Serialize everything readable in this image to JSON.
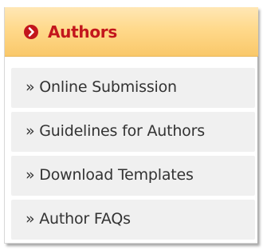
{
  "panel": {
    "title": "Authors",
    "title_icon": "chevron-right-circle-icon",
    "colors": {
      "accent": "#c3161c",
      "header_bg": "#fbd38a",
      "item_bg": "#f0f0f0",
      "item_text": "#333333"
    }
  },
  "menu": {
    "items": [
      {
        "label": "» Online Submission"
      },
      {
        "label": "» Guidelines for Authors"
      },
      {
        "label": "» Download Templates"
      },
      {
        "label": "» Author FAQs"
      }
    ]
  }
}
